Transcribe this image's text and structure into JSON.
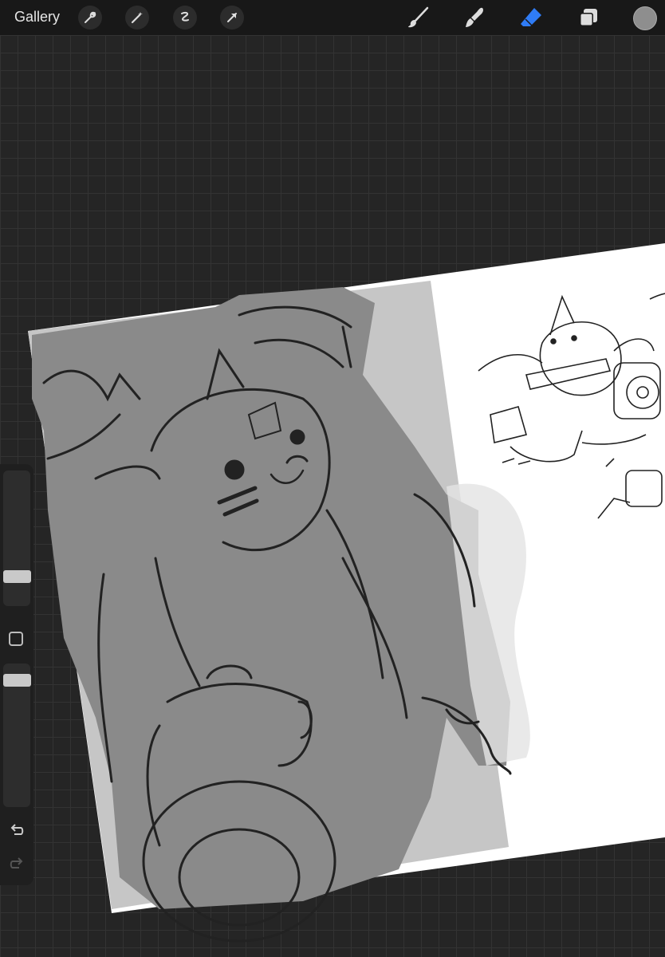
{
  "toolbar": {
    "gallery_label": "Gallery",
    "left_tools": [
      "wrench-icon",
      "magic-wand-icon",
      "selection-icon",
      "transform-arrow-icon"
    ],
    "right_tools": [
      "brush-icon",
      "smudge-icon",
      "eraser-icon",
      "layers-icon"
    ],
    "active_tool": "eraser",
    "accent_color": "#2f7cf6",
    "current_color": "#8e8e8e"
  },
  "sidebar": {
    "brush_size_level": 0.35,
    "opacity_level": 0.72,
    "icons": [
      "modify-square-icon",
      "undo-icon",
      "redo-icon"
    ]
  },
  "canvas": {
    "paper_color": "#ffffff",
    "shade_dark": "#8a8a8a",
    "shade_light": "#c6c6c6"
  }
}
